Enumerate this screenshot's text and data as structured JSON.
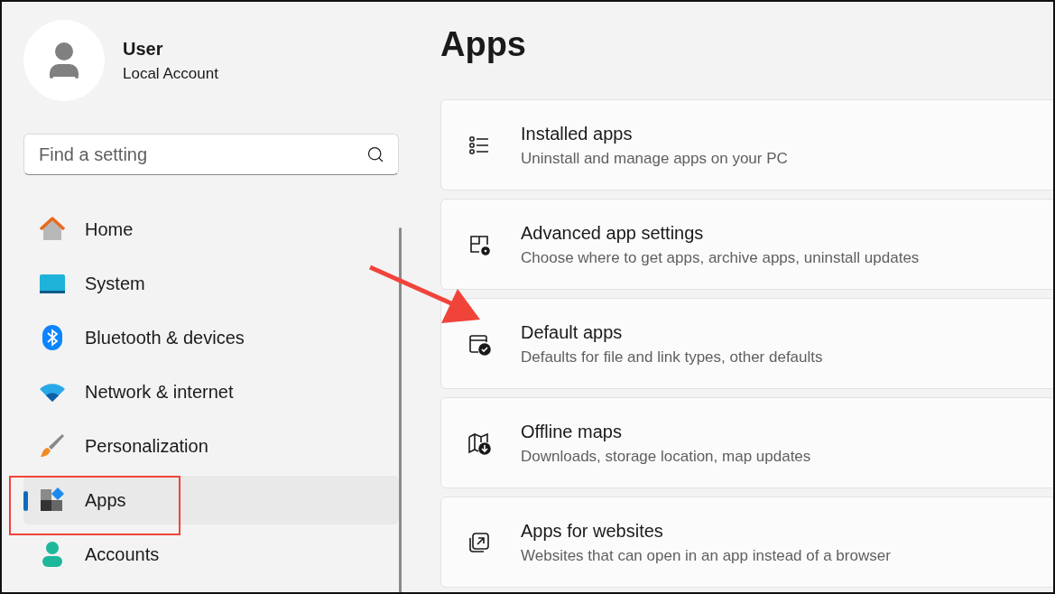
{
  "user": {
    "name": "User",
    "account": "Local Account"
  },
  "search": {
    "placeholder": "Find a setting"
  },
  "nav": [
    {
      "label": "Home",
      "kind": "home",
      "selected": false
    },
    {
      "label": "System",
      "kind": "system",
      "selected": false
    },
    {
      "label": "Bluetooth & devices",
      "kind": "bluetooth",
      "selected": false
    },
    {
      "label": "Network & internet",
      "kind": "network",
      "selected": false
    },
    {
      "label": "Personalization",
      "kind": "brush",
      "selected": false
    },
    {
      "label": "Apps",
      "kind": "apps",
      "selected": true
    },
    {
      "label": "Accounts",
      "kind": "accounts",
      "selected": false
    }
  ],
  "page": {
    "title": "Apps"
  },
  "cards": [
    {
      "kind": "list",
      "title": "Installed apps",
      "description": "Uninstall and manage apps on your PC"
    },
    {
      "kind": "advanced",
      "title": "Advanced app settings",
      "description": "Choose where to get apps, archive apps, uninstall updates"
    },
    {
      "kind": "default",
      "title": "Default apps",
      "description": "Defaults for file and link types, other defaults"
    },
    {
      "kind": "maps",
      "title": "Offline maps",
      "description": "Downloads, storage location, map updates"
    },
    {
      "kind": "web",
      "title": "Apps for websites",
      "description": "Websites that can open in an app instead of a browser"
    }
  ]
}
